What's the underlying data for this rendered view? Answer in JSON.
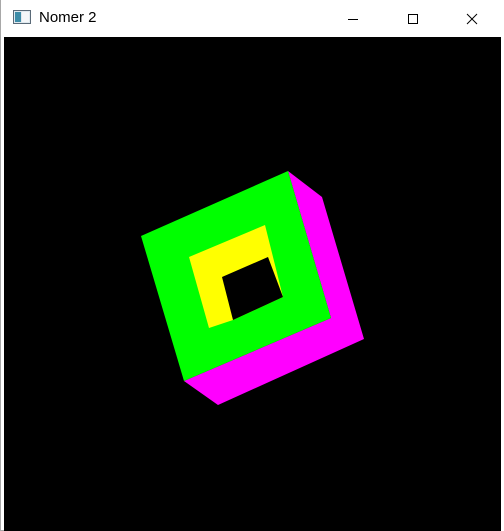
{
  "window": {
    "title": "Nomer 2",
    "icon": "app-window-icon",
    "controls": {
      "minimize": "minimize-icon",
      "maximize": "maximize-icon",
      "close": "close-icon"
    }
  },
  "scene": {
    "background": "#000000",
    "colors": {
      "front_face": "#00ff00",
      "side_face": "#ff00ff",
      "inner_face": "#ffff00",
      "hole": "#000000"
    }
  }
}
